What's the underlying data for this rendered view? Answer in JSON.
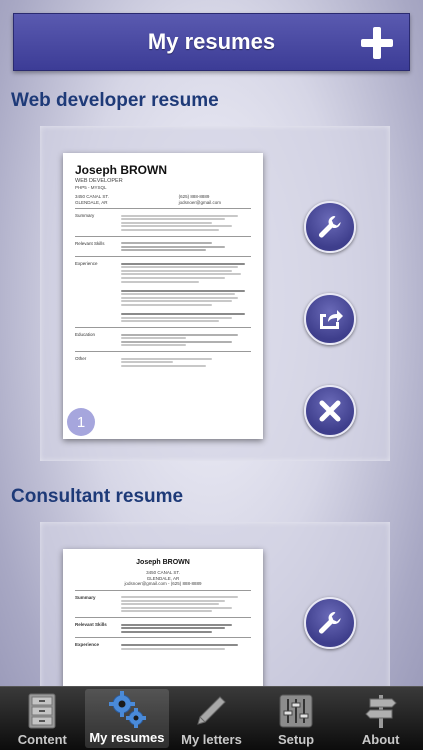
{
  "header": {
    "title": "My resumes",
    "add_icon": "plus-icon"
  },
  "resumes": [
    {
      "section_title": "Web developer resume",
      "name": "Joseph BROWN",
      "role": "WEB DEVELOPER",
      "skills_short": "PHP5 - MYSQL",
      "address_1": "3450 CANAL ST.",
      "address_2": "GLENDALE, AR",
      "phone": "(625) 888-8889",
      "email": "jodsnoer@gmail.com",
      "sections": [
        "Summary",
        "Relevant Skills",
        "Experience",
        "Education",
        "Other"
      ],
      "actions": [
        "wrench-icon",
        "share-icon",
        "delete-icon"
      ],
      "badge": "1"
    },
    {
      "section_title": "Consultant resume",
      "name": "Joseph BROWN",
      "address_1": "3450 CANAL ST.",
      "address_2": "GLENDALE, AR",
      "phone_email": "jodsnoer@gmail.com  -  (625) 888-8889",
      "sections": [
        "Summary",
        "Relevant Skills",
        "Experience"
      ],
      "actions": [
        "wrench-icon"
      ]
    }
  ],
  "tabs": [
    {
      "label": "Content",
      "icon": "cabinet-icon",
      "active": false
    },
    {
      "label": "My resumes",
      "icon": "gears-icon",
      "active": true
    },
    {
      "label": "My letters",
      "icon": "pen-icon",
      "active": false
    },
    {
      "label": "Setup",
      "icon": "sliders-icon",
      "active": false
    },
    {
      "label": "About",
      "icon": "signpost-icon",
      "active": false
    }
  ]
}
